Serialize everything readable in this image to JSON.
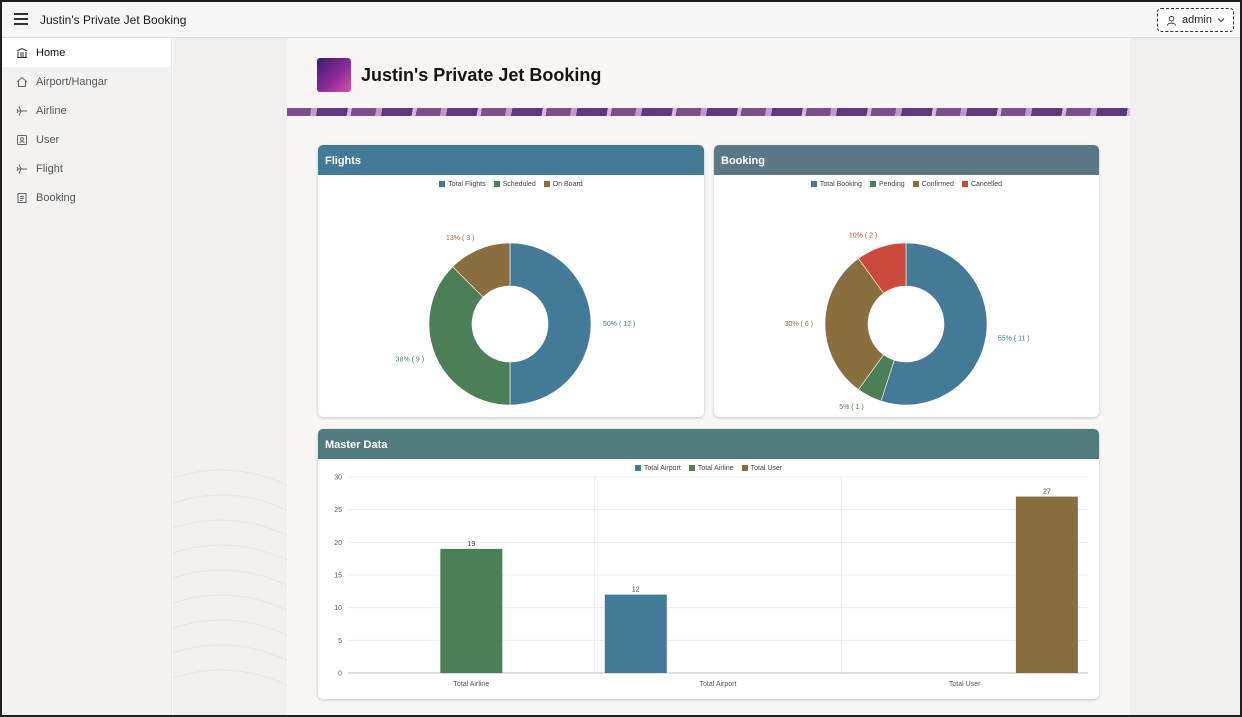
{
  "header": {
    "app_title": "Justin's Private Jet Booking",
    "user": "admin"
  },
  "sidebar": {
    "items": [
      {
        "label": "Home",
        "icon": "home-icon"
      },
      {
        "label": "Airport/Hangar",
        "icon": "hangar-icon"
      },
      {
        "label": "Airline",
        "icon": "plane-icon"
      },
      {
        "label": "User",
        "icon": "user-card-icon"
      },
      {
        "label": "Flight",
        "icon": "plane-icon"
      },
      {
        "label": "Booking",
        "icon": "document-icon"
      }
    ]
  },
  "page": {
    "title": "Justin's Private Jet Booking"
  },
  "colors": {
    "blue": "#437a97",
    "green": "#4c7f56",
    "brown": "#8a6f3e",
    "red": "#cc4a3b",
    "teal_head": "#517a7c"
  },
  "chart_data": [
    {
      "title": "Flights",
      "type": "pie",
      "legend": [
        "Total Flights",
        "Scheduled",
        "On Board"
      ],
      "slices": [
        {
          "name": "Total Flights",
          "value": 12,
          "label": "50% ( 12 )"
        },
        {
          "name": "Scheduled",
          "value": 9,
          "label": "38% ( 9 )"
        },
        {
          "name": "On Board",
          "value": 3,
          "label": "13% ( 3 )"
        }
      ]
    },
    {
      "title": "Booking",
      "type": "pie",
      "legend": [
        "Total Booking",
        "Pending",
        "Confirmed",
        "Cancelled"
      ],
      "slices": [
        {
          "name": "Total Booking",
          "value": 11,
          "label": "55% ( 11 )"
        },
        {
          "name": "Pending",
          "value": 1,
          "label": "5% ( 1 )"
        },
        {
          "name": "Confirmed",
          "value": 6,
          "label": "30% ( 6 )"
        },
        {
          "name": "Cancelled",
          "value": 2,
          "label": "10% ( 2 )"
        }
      ]
    },
    {
      "title": "Master Data",
      "type": "bar",
      "legend": [
        "Total Airport",
        "Total Airline",
        "Total User"
      ],
      "categories": [
        "Total Airline",
        "Total Airport",
        "Total User"
      ],
      "bars": [
        {
          "category": "Total Airline",
          "series": "Total Airline",
          "value": 19
        },
        {
          "category": "Total Airport",
          "series": "Total Airport",
          "value": 12
        },
        {
          "category": "Total User",
          "series": "Total User",
          "value": 27
        }
      ],
      "ylim": [
        0,
        30
      ],
      "yticks": [
        0,
        5,
        10,
        15,
        20,
        25,
        30
      ]
    }
  ]
}
